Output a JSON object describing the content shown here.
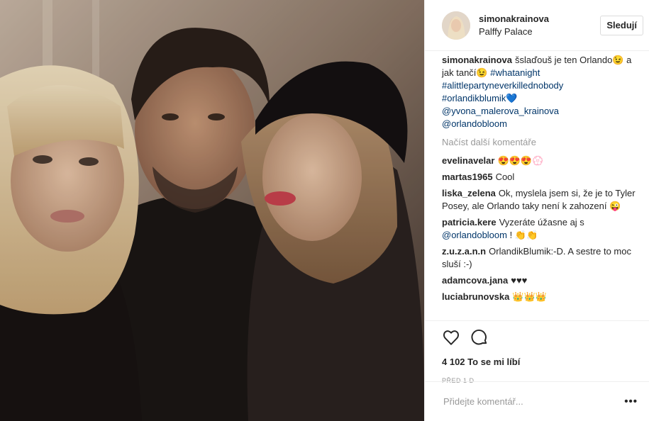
{
  "header": {
    "username": "simonakrainova",
    "location": "Palffy Palace",
    "follow_label": "Sledují"
  },
  "caption": {
    "username": "simonakrainova",
    "text": "šslaďouš je ten Orlando😉 a jak tančí😉",
    "hashtags": [
      "#whatanight",
      "#alittlepartyneverkillednobody",
      "#orlandikblumik💙"
    ],
    "mentions": [
      "@yvona_malerova_krainova",
      "@orlandobloom"
    ]
  },
  "load_more_label": "Načíst další komentáře",
  "comments": [
    {
      "user": "evelinavelar",
      "text": "😍😍😍💮"
    },
    {
      "user": "martas1965",
      "text": "Cool"
    },
    {
      "user": "liska_zelena",
      "text": "Ok, myslela jsem si, že je to Tyler Posey, ale Orlando taky není k zahození 😜"
    },
    {
      "user": "patricia.kere",
      "text": "Vyzeráte úžasne aj s ",
      "mention": "@orlandobloom",
      "suffix": " ! 👏👏"
    },
    {
      "user": "z.u.z.a.n.n",
      "text": "OrlandikBlumik:-D. A sestre to moc sluší :-)"
    },
    {
      "user": "adamcova.jana",
      "text": "♥♥♥"
    },
    {
      "user": "luciabrunovska",
      "text": "👑👑👑"
    }
  ],
  "likes": {
    "count": "4 102",
    "label": "To se mi líbí"
  },
  "time_ago": "PŘED 1 D",
  "add_comment": {
    "placeholder": "Přidejte komentář..."
  },
  "more_label": "•••",
  "icons": {
    "like": "heart-icon",
    "comment": "comment-icon"
  },
  "colors": {
    "link": "#003569",
    "muted": "#999999",
    "border": "#efefef"
  }
}
